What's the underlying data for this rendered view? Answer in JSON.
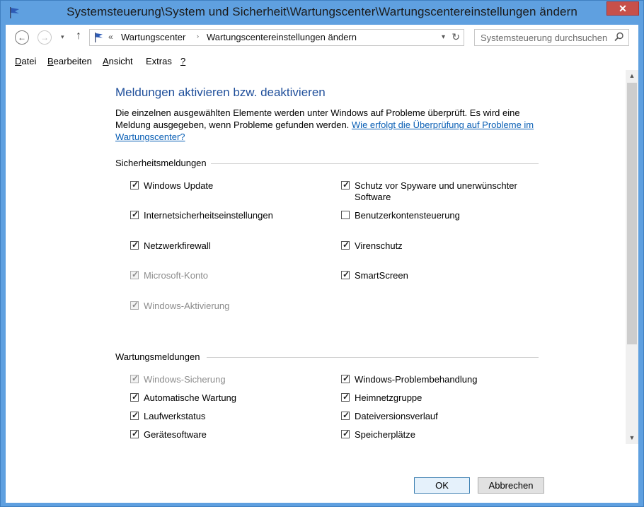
{
  "window": {
    "title": "Systemsteuerung\\System und Sicherheit\\Wartungscenter\\Wartungscentereinstellungen ändern",
    "close_glyph": "✕"
  },
  "nav": {
    "back_glyph": "←",
    "forward_glyph": "→",
    "dropdown_glyph": "▾",
    "up_glyph": "↑",
    "address_prefix": "«",
    "crumbs": [
      "Wartungscenter",
      "Wartungscentereinstellungen ändern"
    ],
    "crumb_arrow": "›",
    "address_dropdown_glyph": "▾",
    "refresh_glyph": "↻",
    "search_placeholder": "Systemsteuerung durchsuchen"
  },
  "menu": [
    {
      "underline": "D",
      "rest": "atei"
    },
    {
      "underline": "B",
      "rest": "earbeiten"
    },
    {
      "underline": "A",
      "rest": "nsicht"
    },
    {
      "underline": "",
      "rest": "Extras"
    },
    {
      "underline": "?",
      "rest": ""
    }
  ],
  "heading": "Meldungen aktivieren bzw. deaktivieren",
  "intro": {
    "text": "Die einzelnen ausgewählten Elemente werden unter Windows auf Probleme überprüft. Es wird eine Meldung ausgegeben, wenn Probleme gefunden werden. ",
    "link": "Wie erfolgt die Überprüfung auf Probleme im Wartungscenter?"
  },
  "security": {
    "label": "Sicherheitsmeldungen",
    "left": [
      {
        "label": "Windows Update",
        "checked": true,
        "disabled": false
      },
      {
        "label": "Internetsicherheitseinstellungen",
        "checked": true,
        "disabled": false
      },
      {
        "label": "Netzwerkfirewall",
        "checked": true,
        "disabled": false
      },
      {
        "label": "Microsoft-Konto",
        "checked": true,
        "disabled": true
      },
      {
        "label": "Windows-Aktivierung",
        "checked": true,
        "disabled": true
      }
    ],
    "right": [
      {
        "label": "Schutz vor Spyware und unerwünschter",
        "label2": "Software",
        "checked": true,
        "disabled": false
      },
      {
        "label": "Benutzerkontensteuerung",
        "checked": false,
        "disabled": false
      },
      {
        "label": "Virenschutz",
        "checked": true,
        "disabled": false
      },
      {
        "label": "SmartScreen",
        "checked": true,
        "disabled": false
      }
    ]
  },
  "maintenance": {
    "label": "Wartungsmeldungen",
    "left": [
      {
        "label": "Windows-Sicherung",
        "checked": true,
        "disabled": true
      },
      {
        "label": "Automatische Wartung",
        "checked": true,
        "disabled": false
      },
      {
        "label": "Laufwerkstatus",
        "checked": true,
        "disabled": false
      },
      {
        "label": "Gerätesoftware",
        "checked": true,
        "disabled": false
      }
    ],
    "right": [
      {
        "label": "Windows-Problembehandlung",
        "checked": true,
        "disabled": false
      },
      {
        "label": "Heimnetzgruppe",
        "checked": true,
        "disabled": false
      },
      {
        "label": "Dateiversionsverlauf",
        "checked": true,
        "disabled": false
      },
      {
        "label": "Speicherplätze",
        "checked": true,
        "disabled": false
      }
    ]
  },
  "buttons": {
    "ok": "OK",
    "cancel": "Abbrechen"
  },
  "scroll": {
    "up_glyph": "▲",
    "down_glyph": "▼"
  },
  "colors": {
    "accent": "#1e4e9a",
    "link": "#0a5fb5",
    "frame": "#5fa0e0"
  }
}
